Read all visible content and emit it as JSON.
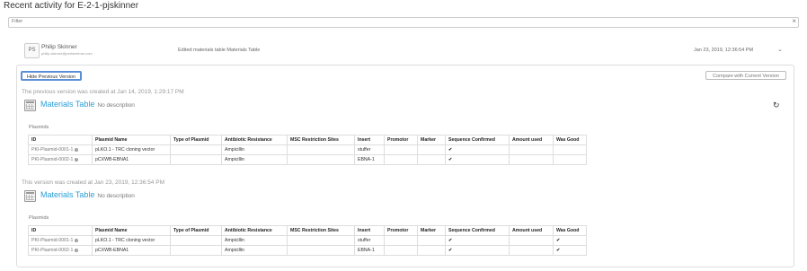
{
  "page": {
    "title": "Recent activity for E-2-1-pjskinner"
  },
  "filter": {
    "placeholder": "Filter",
    "clear_glyph": "×"
  },
  "activity": {
    "initials": "PS",
    "user_name": "Philip Skinner",
    "user_email": "philip.skinner@perkinelmer.com",
    "description": "Edited materials table Materials Table",
    "timestamp": "Jan 23, 2019, 12:36:54 PM",
    "expand_icon": "chevron-down-icon"
  },
  "panel": {
    "hide_button": "Hide Previous Version",
    "compare_button": "Compare with Current Version",
    "previous_note": "The previous version was created at Jan 14, 2019, 1:29:17 PM",
    "current_note": "This version was created at Jan 23, 2019, 12:36:54 PM",
    "table_title": "Materials Table",
    "no_description": "No description",
    "section_label": "Plasmids",
    "columns": [
      "ID",
      "Plasmid Name",
      "Type of Plasmid",
      "Antibiotic Resistance",
      "MSC Restriction Sites",
      "Insert",
      "Promotor",
      "Marker",
      "Sequence Confirmed",
      "Amount used",
      "Was Good"
    ],
    "previous_rows": [
      {
        "id": "PKI-Plasmid-0001-1",
        "name": "pLKO.1 - TRC cloning vector",
        "type": "",
        "antibiotic": "Ampicillin",
        "msc": "",
        "insert": "stuffer",
        "promotor": "",
        "marker": "",
        "seq": true,
        "amount": "",
        "good": false
      },
      {
        "id": "PKI-Plasmid-0002-1",
        "name": "pCXWB-EBNA1",
        "type": "",
        "antibiotic": "Ampicillin",
        "msc": "",
        "insert": "EBNA-1",
        "promotor": "",
        "marker": "",
        "seq": true,
        "amount": "",
        "good": false
      }
    ],
    "current_rows": [
      {
        "id": "PKI-Plasmid-0001-1",
        "name": "pLKO.1 - TRC cloning vector",
        "type": "",
        "antibiotic": "Ampicillin",
        "msc": "",
        "insert": "stuffer",
        "promotor": "",
        "marker": "",
        "seq": true,
        "amount": "",
        "good": true
      },
      {
        "id": "PKI-Plasmid-0002-1",
        "name": "pCXWB-EBNA1",
        "type": "",
        "antibiotic": "Ampicillin",
        "msc": "",
        "insert": "EBNA-1",
        "promotor": "",
        "marker": "",
        "seq": true,
        "amount": "",
        "good": true
      }
    ]
  },
  "icons": {
    "table": "table-icon",
    "restore": "restore-icon",
    "info": "info-icon",
    "check": "check-icon"
  }
}
